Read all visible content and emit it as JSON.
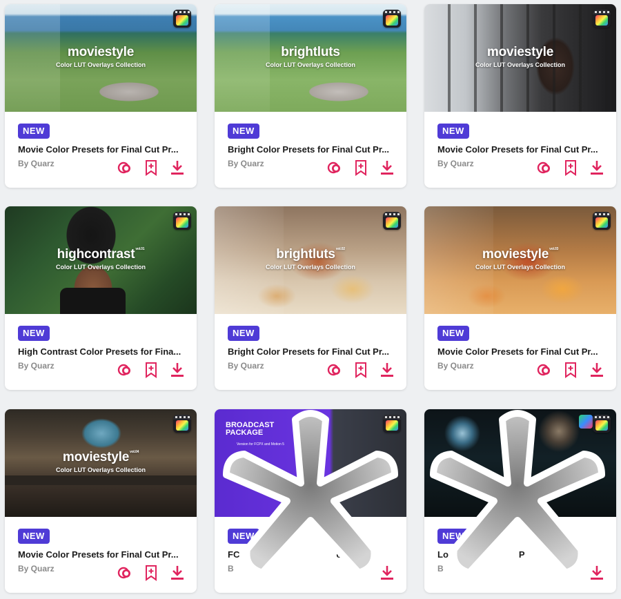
{
  "colors": {
    "badge": "#4f3bd6",
    "action": "#e0245e",
    "author": "#8a8a8a",
    "title": "#1c1c1c"
  },
  "cards": [
    {
      "badge": "NEW",
      "title": "Movie Color Presets for Final Cut Pr...",
      "author": "By Quarz",
      "thumb_title": "moviestyle",
      "thumb_sub": "Color LUT Overlays Collection",
      "thumb_vol": ""
    },
    {
      "badge": "NEW",
      "title": "Bright Color Presets for Final Cut Pr...",
      "author": "By Quarz",
      "thumb_title": "brightluts",
      "thumb_sub": "Color LUT Overlays Collection",
      "thumb_vol": ""
    },
    {
      "badge": "NEW",
      "title": "Movie Color Presets for Final Cut Pr...",
      "author": "By Quarz",
      "thumb_title": "moviestyle",
      "thumb_sub": "Color LUT Overlays Collection",
      "thumb_vol": ""
    },
    {
      "badge": "NEW",
      "title": "High Contrast Color Presets for Fina...",
      "author": "By Quarz",
      "thumb_title": "highcontrast",
      "thumb_sub": "Color LUT Overlays Collection",
      "thumb_vol": "vol.01"
    },
    {
      "badge": "NEW",
      "title": "Bright Color Presets for Final Cut Pr...",
      "author": "By Quarz",
      "thumb_title": "brightluts",
      "thumb_sub": "Color LUT Overlays Collection",
      "thumb_vol": "vol.02"
    },
    {
      "badge": "NEW",
      "title": "Movie Color Presets for Final Cut Pr...",
      "author": "By Quarz",
      "thumb_title": "moviestyle",
      "thumb_sub": "Color LUT Overlays Collection",
      "thumb_vol": "vol.03"
    },
    {
      "badge": "NEW",
      "title": "Movie Color Presets for Final Cut Pr...",
      "author": "By Quarz",
      "thumb_title": "moviestyle",
      "thumb_sub": "Color LUT Overlays Collection",
      "thumb_vol": "vol.04"
    },
    {
      "badge": "NEW",
      "title": "FC",
      "title_tail": "ck",
      "author": "B",
      "thumb_heading": "BROADCAST PACKAGE",
      "thumb_small": "Version for FCPX and Motion 5"
    },
    {
      "badge": "NEW",
      "title": "Lo",
      "title_tail": "P",
      "author": "B"
    }
  ],
  "icons": {
    "thumb_badge": "final-cut-pro-icon",
    "actions": [
      "collections-icon",
      "bookmark-add-icon",
      "download-icon"
    ]
  }
}
